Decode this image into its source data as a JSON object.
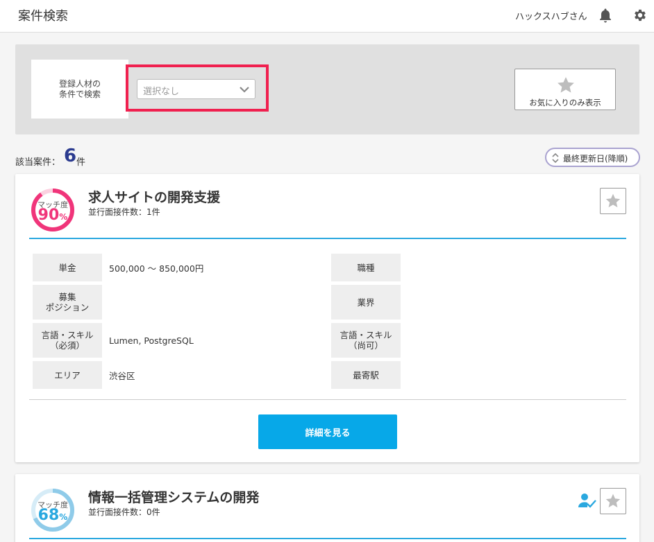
{
  "header": {
    "title": "案件検索",
    "user_name": "ハックスハブさん",
    "icons": [
      "bell-icon",
      "gear-icon"
    ]
  },
  "search": {
    "label": "登録人材の\n条件で検索",
    "select_value": "選択なし",
    "favorites_label": "お気に入りのみ表示"
  },
  "results": {
    "count_label": "該当案件：",
    "count": "6",
    "count_unit": "件",
    "sort_label": "最終更新日(降順)"
  },
  "colors": {
    "accent_blue": "#07a8e8",
    "highlight_red": "#f0204f",
    "match_pink": "#f0357a",
    "match_blue": "#2aa8df",
    "count_navy": "#2b3b8f"
  },
  "jobs": [
    {
      "match_label": "マッチ度",
      "match_value": "90",
      "match_unit": "%",
      "match_fraction": 0.9,
      "title": "求人サイトの開発支援",
      "subtitle": "並行面接件数：1件",
      "fields": {
        "price_label": "単金",
        "price_value": "500,000 ～ 850,000円",
        "job_type_label": "職種",
        "job_type_value": "",
        "position_label": "募集\nポジション",
        "position_value": "",
        "industry_label": "業界",
        "industry_value": "",
        "skills_required_label": "言語・スキル\n（必須）",
        "skills_required_value": "Lumen, PostgreSQL",
        "skills_optional_label": "言語・スキル\n（尚可）",
        "skills_optional_value": "",
        "area_label": "エリア",
        "area_value": "渋谷区",
        "station_label": "最寄駅",
        "station_value": ""
      },
      "detail_button_label": "詳細を見る"
    },
    {
      "match_label": "マッチ度",
      "match_value": "68",
      "match_unit": "%",
      "match_fraction": 0.68,
      "title": "情報一括管理システムの開発",
      "subtitle": "並行面接件数：0件"
    }
  ]
}
